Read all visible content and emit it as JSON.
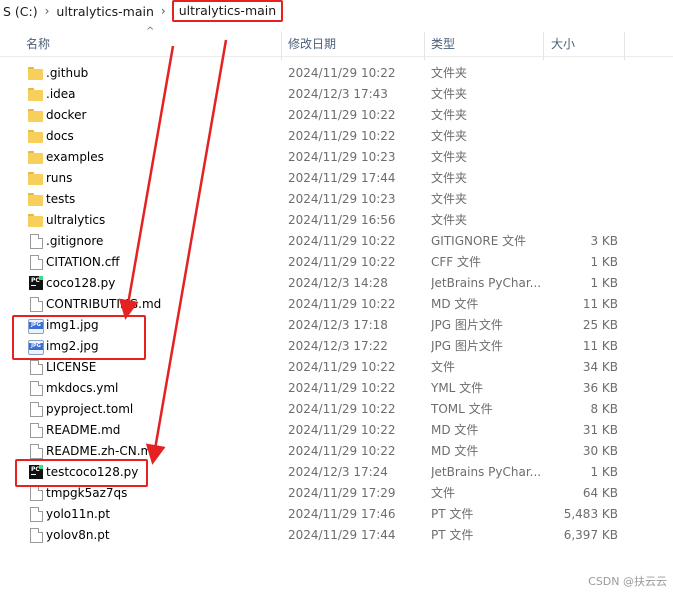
{
  "breadcrumb": {
    "drive": "S (C:)",
    "segments": [
      "ultralytics-main"
    ],
    "current": "ultralytics-main"
  },
  "columns": {
    "name": "名称",
    "date": "修改日期",
    "type": "类型",
    "size": "大小"
  },
  "files": [
    {
      "name": ".github",
      "date": "2024/11/29 10:22",
      "type": "文件夹",
      "size": "",
      "icon": "folder-icon"
    },
    {
      "name": ".idea",
      "date": "2024/12/3 17:43",
      "type": "文件夹",
      "size": "",
      "icon": "folder-icon"
    },
    {
      "name": "docker",
      "date": "2024/11/29 10:22",
      "type": "文件夹",
      "size": "",
      "icon": "folder-icon"
    },
    {
      "name": "docs",
      "date": "2024/11/29 10:22",
      "type": "文件夹",
      "size": "",
      "icon": "folder-icon"
    },
    {
      "name": "examples",
      "date": "2024/11/29 10:23",
      "type": "文件夹",
      "size": "",
      "icon": "folder-icon"
    },
    {
      "name": "runs",
      "date": "2024/11/29 17:44",
      "type": "文件夹",
      "size": "",
      "icon": "folder-icon"
    },
    {
      "name": "tests",
      "date": "2024/11/29 10:23",
      "type": "文件夹",
      "size": "",
      "icon": "folder-icon"
    },
    {
      "name": "ultralytics",
      "date": "2024/11/29 16:56",
      "type": "文件夹",
      "size": "",
      "icon": "folder-icon"
    },
    {
      "name": ".gitignore",
      "date": "2024/11/29 10:22",
      "type": "GITIGNORE 文件",
      "size": "3 KB",
      "icon": "file-icon"
    },
    {
      "name": "CITATION.cff",
      "date": "2024/11/29 10:22",
      "type": "CFF 文件",
      "size": "1 KB",
      "icon": "file-icon"
    },
    {
      "name": "coco128.py",
      "date": "2024/12/3 14:28",
      "type": "JetBrains PyChar...",
      "size": "1 KB",
      "icon": "pycharm-icon"
    },
    {
      "name": "CONTRIBUTING.md",
      "date": "2024/11/29 10:22",
      "type": "MD 文件",
      "size": "11 KB",
      "icon": "file-icon"
    },
    {
      "name": "img1.jpg",
      "date": "2024/12/3 17:18",
      "type": "JPG 图片文件",
      "size": "25 KB",
      "icon": "jpg-icon"
    },
    {
      "name": "img2.jpg",
      "date": "2024/12/3 17:22",
      "type": "JPG 图片文件",
      "size": "11 KB",
      "icon": "jpg-icon"
    },
    {
      "name": "LICENSE",
      "date": "2024/11/29 10:22",
      "type": "文件",
      "size": "34 KB",
      "icon": "file-icon"
    },
    {
      "name": "mkdocs.yml",
      "date": "2024/11/29 10:22",
      "type": "YML 文件",
      "size": "36 KB",
      "icon": "file-icon"
    },
    {
      "name": "pyproject.toml",
      "date": "2024/11/29 10:22",
      "type": "TOML 文件",
      "size": "8 KB",
      "icon": "file-icon"
    },
    {
      "name": "README.md",
      "date": "2024/11/29 10:22",
      "type": "MD 文件",
      "size": "31 KB",
      "icon": "file-icon"
    },
    {
      "name": "README.zh-CN.md",
      "date": "2024/11/29 10:22",
      "type": "MD 文件",
      "size": "30 KB",
      "icon": "file-icon"
    },
    {
      "name": "testcoco128.py",
      "date": "2024/12/3 17:24",
      "type": "JetBrains PyChar...",
      "size": "1 KB",
      "icon": "pycharm-icon"
    },
    {
      "name": "tmpgk5az7qs",
      "date": "2024/11/29 17:29",
      "type": "文件",
      "size": "64 KB",
      "icon": "file-icon"
    },
    {
      "name": "yolo11n.pt",
      "date": "2024/11/29 17:46",
      "type": "PT 文件",
      "size": "5,483 KB",
      "icon": "file-icon"
    },
    {
      "name": "yolov8n.pt",
      "date": "2024/11/29 17:44",
      "type": "PT 文件",
      "size": "6,397 KB",
      "icon": "file-icon"
    }
  ],
  "watermark": "CSDN @扶云云",
  "colors": {
    "annotation": "#e52222",
    "folder": "#f7cf5b",
    "header_text": "#4c607a"
  }
}
